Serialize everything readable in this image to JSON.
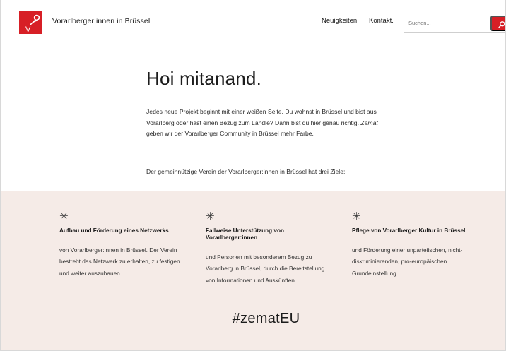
{
  "header": {
    "site_title": "Vorarlberger:innen in Brüssel",
    "logo_letter": "V",
    "nav": {
      "news": "Neuigkeiten.",
      "contact": "Kontakt."
    },
    "search": {
      "placeholder": "Suchen...",
      "icon": "search-icon"
    }
  },
  "colors": {
    "brand_red": "#d71f26",
    "band_bg": "#f5ebe7"
  },
  "main": {
    "headline": "Hoi mitanand.",
    "intro_part1": "Jedes neue Projekt beginnt mit einer weißen Seite. Du wohnst in Brüssel und bist aus Vorarlberg oder hast einen Bezug zum Ländle? Dann bist du hier genau richtig. ",
    "intro_em": "Zemat",
    "intro_part2": " geben wir der Vorarlberger Community in Brüssel mehr Farbe.",
    "goals_lead": "Der gemeinnützige Verein der Vorarlberger:innen in Brüssel hat drei Ziele:"
  },
  "goals": [
    {
      "icon": "asterisk-icon",
      "star": "✳",
      "title": "Aufbau und Förderung eines Netzwerks",
      "text": "von Vorarlberger:innen in Brüssel. Der Verein bestrebt das Netzwerk zu erhalten, zu festigen und weiter auszubauen."
    },
    {
      "icon": "asterisk-icon",
      "star": "✳",
      "title": "Fallweise Unterstützung von Vorarlberger:innen",
      "text": "und Personen mit besonderem Bezug zu Vorarlberg in Brüssel, durch die Bereitstellung von Informationen und Auskünften."
    },
    {
      "icon": "asterisk-icon",
      "star": "✳",
      "title": "Pflege von Vorarlberger Kultur in Brüssel",
      "text": "und Förderung einer unparteiischen, nicht-diskriminierenden, pro-europäischen Grundeinstellung."
    }
  ],
  "hashtag": "#zematEU"
}
